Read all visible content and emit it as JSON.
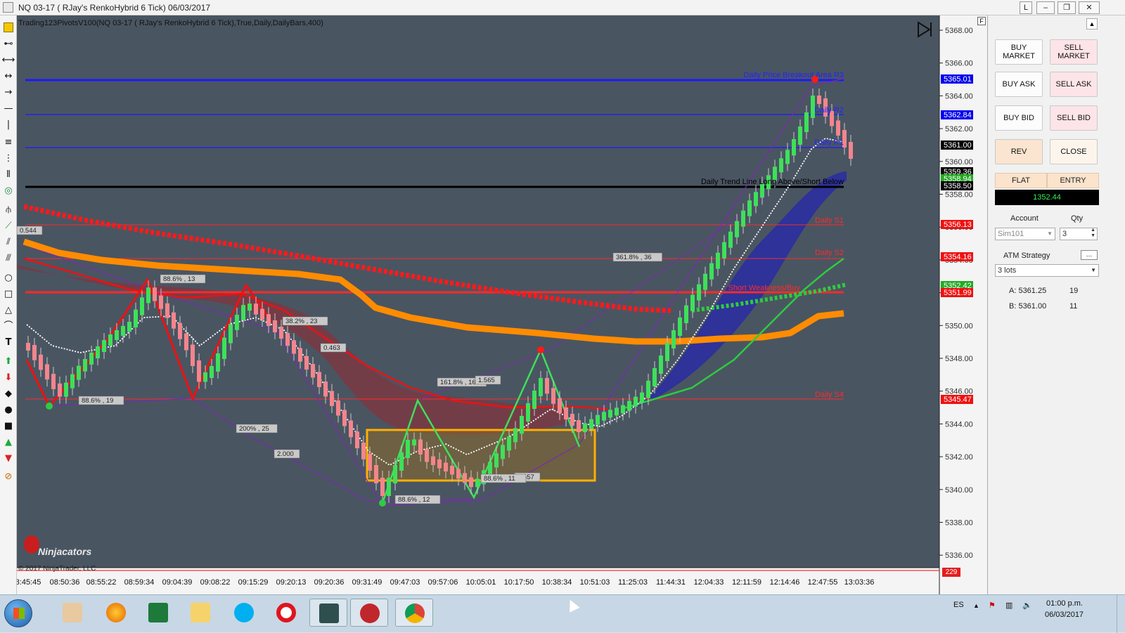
{
  "window": {
    "title": "NQ 03-17 ( RJay's RenkoHybrid  6 Tick)  06/03/2017",
    "buttons": [
      "L",
      "–",
      "❐",
      "✕"
    ]
  },
  "chart": {
    "indicator_label": "Trading123PivotsV100(NQ 03-17 ( RJay's RenkoHybrid  6 Tick),True,Daily,DailyBars,400)",
    "watermark": "Ninjacators",
    "copyright": "© 2017 NinjaTrader, LLC",
    "corner_badge": "229",
    "f_button": "F",
    "time_labels": [
      "8:45:45",
      "08:50:36",
      "08:55:22",
      "08:59:34",
      "09:04:39",
      "09:08:22",
      "09:15:29",
      "09:20:13",
      "09:20:36",
      "09:31:49",
      "09:47:03",
      "09:57:06",
      "10:05:01",
      "10:17:50",
      "10:38:34",
      "10:51:03",
      "11:25:03",
      "11:44:31",
      "12:04:33",
      "12:11:59",
      "12:14:46",
      "12:47:55",
      "13:03:36"
    ],
    "price_labels": [
      "5368.00",
      "5366.00",
      "5364.00",
      "5362.00",
      "5360.00",
      "5358.00",
      "5356.00",
      "5354.00",
      "5352.00",
      "5350.00",
      "5348.00",
      "5346.00",
      "5344.00",
      "5342.00",
      "5340.00",
      "5338.00",
      "5336.00"
    ],
    "price_tags": [
      {
        "text": "5365.01",
        "color": "#0000ee"
      },
      {
        "text": "5362.84",
        "color": "#0000ee"
      },
      {
        "text": "5361.00",
        "color": "#000000"
      },
      {
        "text": "5359.36",
        "color": "#000000"
      },
      {
        "text": "5358.94",
        "color": "#22aa22"
      },
      {
        "text": "5358.50",
        "color": "#000000"
      },
      {
        "text": "5356.13",
        "color": "#ee1111"
      },
      {
        "text": "5354.16",
        "color": "#ee1111"
      },
      {
        "text": "5352.42",
        "color": "#22aa22"
      },
      {
        "text": "5351.99",
        "color": "#ee1111"
      },
      {
        "text": "5345.47",
        "color": "#ee1111"
      }
    ],
    "level_labels": [
      {
        "text": "Daily Price Breakout Area R3",
        "color": "#2323ff"
      },
      {
        "text": "Daily R2",
        "color": "#2323ff"
      },
      {
        "text": "Daily R1",
        "color": "#2323ff"
      },
      {
        "text": "Daily Trend Line  Long Above/Short Below",
        "color": "#000000"
      },
      {
        "text": "Daily S1",
        "color": "#ff2a2a"
      },
      {
        "text": "Daily S2",
        "color": "#ff2a2a"
      },
      {
        "text": "Short Weakness/Buy",
        "color": "#ff2a2a"
      },
      {
        "text": "Daily S4",
        "color": "#ff2a2a"
      }
    ],
    "fib_labels": [
      "88.6% , 13",
      "38.2% , 23",
      "0.463",
      "88.6% , 19",
      "200% , 25",
      "2.000",
      "161.8% , 16",
      "1.565",
      "361.8% , 36",
      "88.6% , 12",
      "0.544",
      "1.557",
      "88.6% , 11"
    ],
    "colors": {
      "background": "#4a5562",
      "bull": "#3ee05a",
      "bear": "#f4858d",
      "r_levels": "#1a1aff",
      "s_levels": "#ff2a2a",
      "trend": "#000000",
      "orange": "#ff8c00",
      "box": "#ffb000"
    }
  },
  "order_panel": {
    "buttons": {
      "buy_market": "BUY\nMARKET",
      "sell_market": "SELL\nMARKET",
      "buy_ask": "BUY ASK",
      "sell_ask": "SELL ASK",
      "buy_bid": "BUY BID",
      "sell_bid": "SELL BID",
      "rev": "REV",
      "close": "CLOSE"
    },
    "tabs": {
      "flat": "FLAT",
      "entry": "ENTRY"
    },
    "pnl": "1352.44",
    "account_label": "Account",
    "qty_label": "Qty",
    "account_value": "Sim101",
    "qty_value": "3",
    "atm_label": "ATM Strategy",
    "atm_value": "3 lots",
    "ask_label": "A: 5361.25",
    "ask_size": "19",
    "bid_label": "B: 5361.00",
    "bid_size": "11"
  },
  "taskbar": {
    "lang": "ES",
    "time": "01:00 p.m.",
    "date": "06/03/2017"
  }
}
